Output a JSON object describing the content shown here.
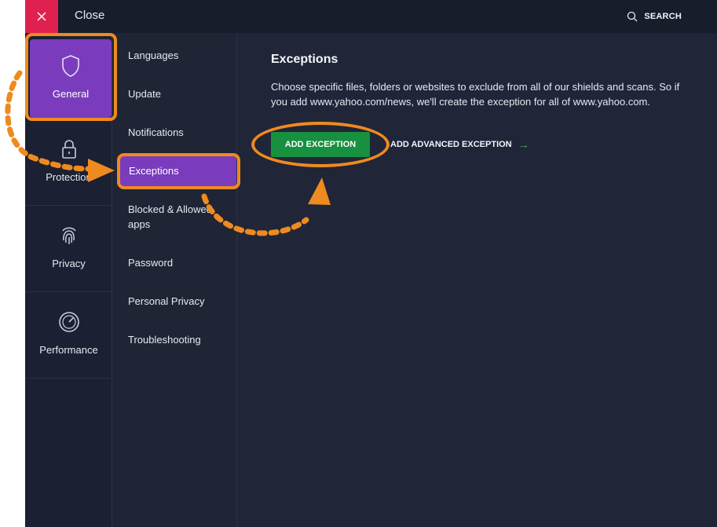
{
  "topbar": {
    "close_label": "Close",
    "search_label": "SEARCH"
  },
  "categories": [
    {
      "label": "General",
      "icon": "shield-icon",
      "active": true
    },
    {
      "label": "Protection",
      "icon": "lock-icon",
      "active": false
    },
    {
      "label": "Privacy",
      "icon": "fingerprint-icon",
      "active": false
    },
    {
      "label": "Performance",
      "icon": "speedometer-icon",
      "active": false
    }
  ],
  "submenu": [
    {
      "label": "Languages"
    },
    {
      "label": "Update"
    },
    {
      "label": "Notifications"
    },
    {
      "label": "Exceptions",
      "active": true
    },
    {
      "label": "Blocked & Allowed apps"
    },
    {
      "label": "Password"
    },
    {
      "label": "Personal Privacy"
    },
    {
      "label": "Troubleshooting"
    }
  ],
  "main": {
    "title": "Exceptions",
    "description": "Choose specific files, folders or websites to exclude from all of our shields and scans. So if you add www.yahoo.com/news, we'll create the exception for all of www.yahoo.com.",
    "add_button": "ADD EXCEPTION",
    "advanced_link": "ADD ADVANCED EXCEPTION"
  },
  "colors": {
    "accent_purple": "#7a3cbd",
    "button_green": "#17903f",
    "close_red": "#e0214f",
    "annotation_orange": "#ef8a1f"
  }
}
